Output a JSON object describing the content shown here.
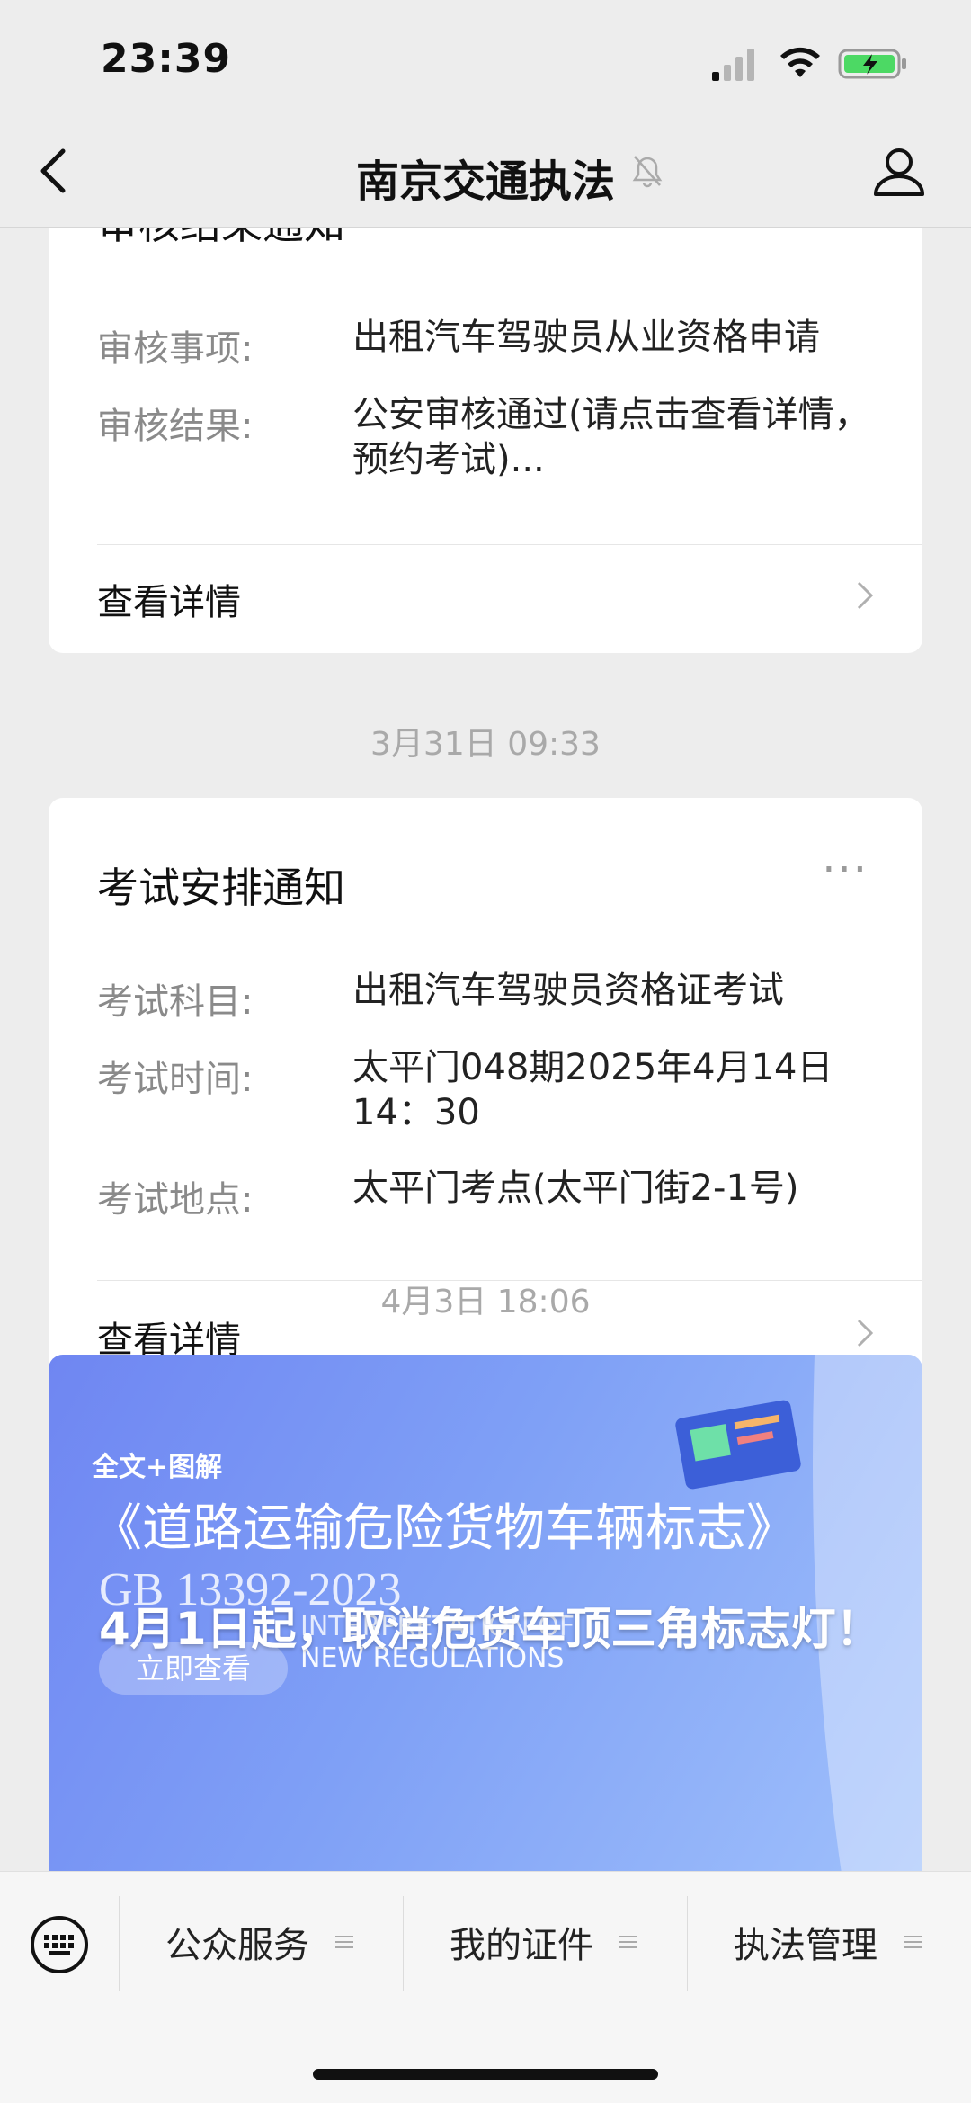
{
  "status_bar": {
    "time": "23:39"
  },
  "nav": {
    "title": "南京交通执法"
  },
  "card1": {
    "partial_title": "审核结果通知",
    "rows": [
      {
        "label": "审核事项:",
        "value": "出租汽车驾驶员从业资格申请"
      },
      {
        "label": "审核结果:",
        "value": "公安审核通过(请点击查看详情，预约考试)..."
      }
    ],
    "detail_label": "查看详情"
  },
  "timestamp1": "3月31日 09:33",
  "card2": {
    "title": "考试安排通知",
    "more": "···",
    "rows": [
      {
        "label": "考试科目:",
        "value": "出租汽车驾驶员资格证考试"
      },
      {
        "label": "考试时间:",
        "value": "太平门048期2025年4月14日14：30"
      },
      {
        "label": "考试地点:",
        "value": "太平门考点(太平门街2-1号)"
      }
    ],
    "detail_label": "查看详情"
  },
  "timestamp2": "4月3日 18:06",
  "banner": {
    "tag": "全文+图解",
    "heading": "《道路运输危险货物车辆标志》",
    "code": "GB 13392-2023",
    "button": "立即查看",
    "sub1": "INTERPRETATION OF",
    "sub2": "NEW REGULATIONS",
    "overlay": "4月1日起，取消危货车顶三角标志灯！"
  },
  "bottom_menu": {
    "items": [
      "公众服务",
      "我的证件",
      "执法管理"
    ]
  },
  "colors": {
    "accent_green": "#4cd964",
    "background": "#ededed"
  }
}
